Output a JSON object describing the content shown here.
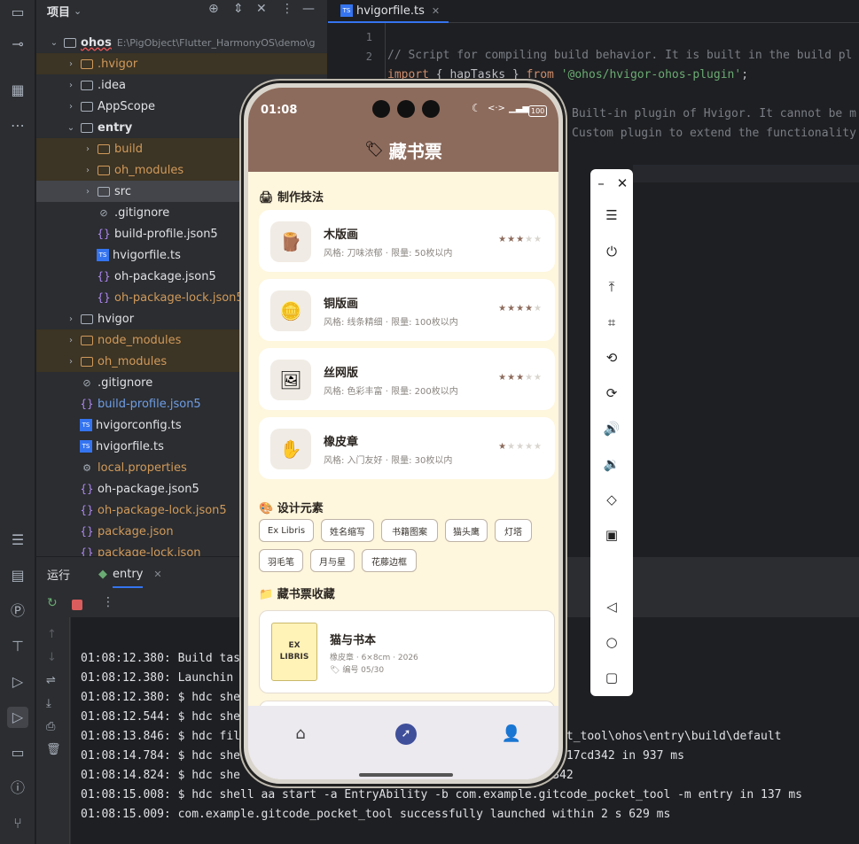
{
  "project": {
    "title": "项目",
    "root_name": "ohos",
    "root_path": "E:\\PigObject\\Flutter_HarmonyOS\\demo\\g",
    "items": [
      {
        "label": ".hvigor",
        "kind": "folder"
      },
      {
        "label": ".idea",
        "kind": "folder"
      },
      {
        "label": "AppScope",
        "kind": "folder"
      },
      {
        "label": "entry",
        "kind": "folder"
      },
      {
        "label": "build",
        "kind": "folder"
      },
      {
        "label": "oh_modules",
        "kind": "folder"
      },
      {
        "label": "src",
        "kind": "folder"
      },
      {
        "label": ".gitignore",
        "kind": "file"
      },
      {
        "label": "build-profile.json5",
        "kind": "file"
      },
      {
        "label": "hvigorfile.ts",
        "kind": "file"
      },
      {
        "label": "oh-package.json5",
        "kind": "file"
      },
      {
        "label": "oh-package-lock.json5",
        "kind": "file"
      },
      {
        "label": "hvigor",
        "kind": "folder"
      },
      {
        "label": "node_modules",
        "kind": "folder"
      },
      {
        "label": "oh_modules",
        "kind": "folder"
      },
      {
        "label": ".gitignore",
        "kind": "file"
      },
      {
        "label": "build-profile.json5",
        "kind": "file"
      },
      {
        "label": "hvigorconfig.ts",
        "kind": "file"
      },
      {
        "label": "hvigorfile.ts",
        "kind": "file"
      },
      {
        "label": "local.properties",
        "kind": "file"
      },
      {
        "label": "oh-package.json5",
        "kind": "file"
      },
      {
        "label": "oh-package-lock.json5",
        "kind": "file"
      },
      {
        "label": "package.json",
        "kind": "file"
      },
      {
        "label": "package-lock.json",
        "kind": "file"
      }
    ]
  },
  "editor": {
    "tab_label": "hvigorfile.ts",
    "lines": {
      "l1": "1",
      "l2": "2",
      "comment1": "// Script for compiling build behavior. It is built in the build pl",
      "import_kw": "import",
      "import_mid": " { hapTasks } ",
      "from_kw": "from",
      "import_str": "'@ohos/hvigor-ohos-plugin'",
      "semi": ";",
      "comment2": "Built-in plugin of Hvigor. It cannot be m",
      "comment3": "Custom plugin to extend the functionality"
    }
  },
  "run": {
    "tab_run": "运行",
    "tab_entry": "entry",
    "log": [
      "01:08:12.380: Build tas",
      "01:08:12.380: Launchin",
      "01:08:12.380: $ hdc she                                   ol",
      "01:08:12.544: $ hdc she                                   43617cd342",
      "01:08:13.846: $ hdc fil                                   itcode_pocket_tool\\ohos\\entry\\build\\default",
      "01:08:14.784: $ hdc she                                   8eba11aea43617cd342 in 937 ms",
      "01:08:14.824: $ hdc she                                   aea43617cd342",
      "01:08:15.008: $ hdc shell aa start -a EntryAbility -b com.example.gitcode_pocket_tool -m entry in 137 ms",
      "01:08:15.009: com.example.gitcode_pocket_tool successfully launched within 2 s 629 ms"
    ]
  },
  "phone": {
    "time": "01:08",
    "battery": "100",
    "app_title": "藏书票",
    "section_tech": "制作技法",
    "techniques": [
      {
        "name": "木版画",
        "desc": "风格: 刀味浓郁 · 限量: 50枚以内",
        "rating": 3,
        "icon": "🪵"
      },
      {
        "name": "铜版画",
        "desc": "风格: 线条精细 · 限量: 100枚以内",
        "rating": 4,
        "icon": "🪙"
      },
      {
        "name": "丝网版",
        "desc": "风格: 色彩丰富 · 限量: 200枚以内",
        "rating": 3,
        "icon": "🖼"
      },
      {
        "name": "橡皮章",
        "desc": "风格: 入门友好 · 限量: 30枚以内",
        "rating": 1,
        "icon": "✋"
      }
    ],
    "section_design": "设计元素",
    "design_chips": [
      "Ex Libris",
      "姓名缩写",
      "书籍图案",
      "猫头鹰",
      "灯塔",
      "羽毛笔",
      "月与星",
      "花藤边框"
    ],
    "section_collection": "藏书票收藏",
    "collection": {
      "thumb_line1": "EX",
      "thumb_line2": "LIBRIS",
      "name": "猫与书本",
      "meta": "橡皮章 · 6×8cm · 2026",
      "number": "编号 05/30"
    }
  },
  "colors": {
    "accent": "#8d6b5c",
    "page_bg": "#fef6dd",
    "ide_bg": "#2b2d30",
    "excluded": "#d19a5b"
  }
}
